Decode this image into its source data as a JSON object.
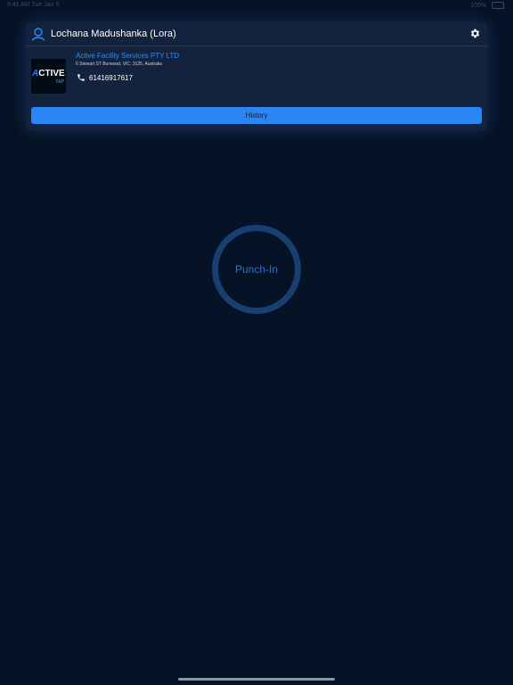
{
  "status_bar": {
    "time": "9:41 AM  Tue Jan 9",
    "battery": "100%"
  },
  "user": {
    "name": "Lochana Madushanka (Lora)",
    "icon": "user-icon"
  },
  "settings": {
    "icon": "gear-icon"
  },
  "company": {
    "logo_text": "ACTIVE",
    "logo_subtext": "TAP",
    "name": "Active Facility Services PTY LTD",
    "address": "6 Stewart ST Burwood, VIC, 3125, Australia",
    "phone": "61416917617",
    "phone_icon": "phone-icon"
  },
  "history_button": {
    "label": "History"
  },
  "punch_in": {
    "label": "Punch-In"
  },
  "colors": {
    "background": "#061326",
    "card": "#13233d",
    "accent": "#2a86f2",
    "ring": "#173f72"
  }
}
